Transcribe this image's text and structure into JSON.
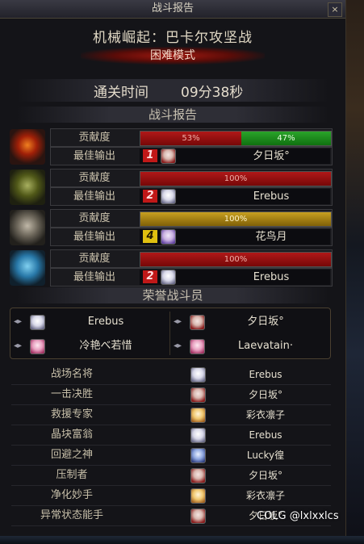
{
  "window": {
    "title": "战斗报告",
    "close_label": "×"
  },
  "raid": {
    "title": "机械崛起：巴卡尔攻坚战",
    "mode": "困难模式"
  },
  "clear_time": {
    "label": "通关时间",
    "value": "09分38秒"
  },
  "report_header": "战斗报告",
  "members": [
    {
      "emblem": "fire",
      "contribution_label": "贡献度",
      "bars": [
        {
          "color": "red",
          "percent": 53,
          "label": "53%"
        },
        {
          "color": "green",
          "percent": 47,
          "label": "47%"
        }
      ],
      "best_label": "最佳输出",
      "best_rank": "1",
      "best_rank_color": "red",
      "best_avatar": "av-red",
      "best_name": "夕日坂°"
    },
    {
      "emblem": "green",
      "contribution_label": "贡献度",
      "bars": [
        {
          "color": "red",
          "percent": 100,
          "label": "100%"
        }
      ],
      "best_label": "最佳输出",
      "best_rank": "2",
      "best_rank_color": "red",
      "best_avatar": "av-white",
      "best_name": "Erebus"
    },
    {
      "emblem": "steel",
      "contribution_label": "贡献度",
      "bars": [
        {
          "color": "gold",
          "percent": 100,
          "label": "100%"
        }
      ],
      "best_label": "最佳输出",
      "best_rank": "4",
      "best_rank_color": "yellow",
      "best_avatar": "av-purple",
      "best_name": "花鸟月"
    },
    {
      "emblem": "ice",
      "contribution_label": "贡献度",
      "bars": [
        {
          "color": "red",
          "percent": 100,
          "label": "100%"
        }
      ],
      "best_label": "最佳输出",
      "best_rank": "2",
      "best_rank_color": "red",
      "best_avatar": "av-white",
      "best_name": "Erebus"
    }
  ],
  "honor_header": "荣誉战斗员",
  "honor": [
    {
      "avatar": "av-white",
      "name": "Erebus"
    },
    {
      "avatar": "av-red",
      "name": "夕日坂°"
    },
    {
      "avatar": "av-pink",
      "name": "冷艳べ若惜"
    },
    {
      "avatar": "av-pink",
      "name": "Laevatain·"
    }
  ],
  "awards": [
    {
      "title": "战场名将",
      "avatar": "av-white",
      "name": "Erebus"
    },
    {
      "title": "一击决胜",
      "avatar": "av-red",
      "name": "夕日坂°"
    },
    {
      "title": "救援专家",
      "avatar": "av-blond",
      "name": "彩衣凛子"
    },
    {
      "title": "晶块富翁",
      "avatar": "av-white",
      "name": "Erebus"
    },
    {
      "title": "回避之神",
      "avatar": "av-blue",
      "name": "Lucky徨"
    },
    {
      "title": "压制者",
      "avatar": "av-red",
      "name": "夕日坂°"
    },
    {
      "title": "净化妙手",
      "avatar": "av-blond",
      "name": "彩衣凛子"
    },
    {
      "title": "异常状态能手",
      "avatar": "av-red",
      "name": "夕日坂°"
    }
  ],
  "watermark": "COLG @lxlxxlcs"
}
